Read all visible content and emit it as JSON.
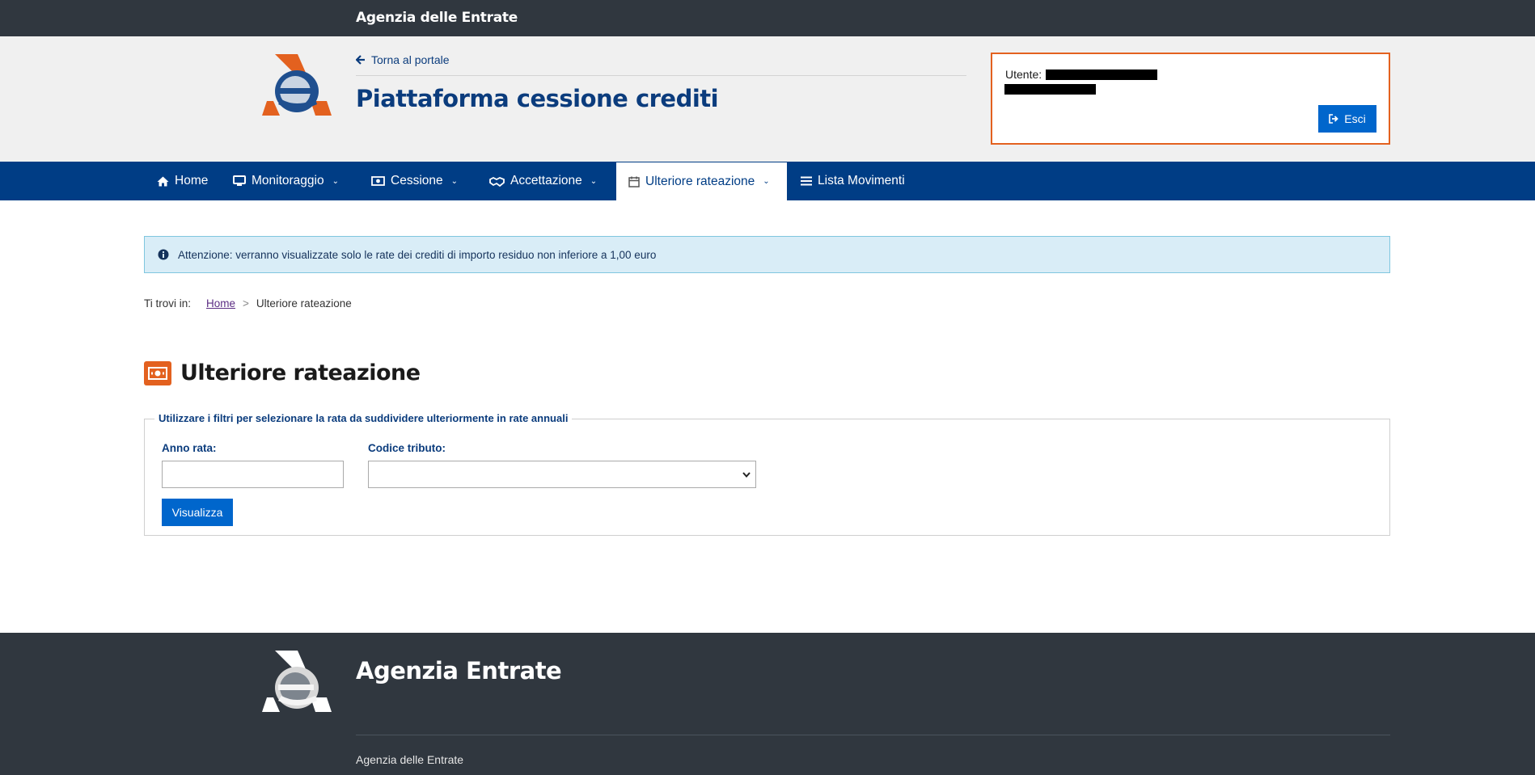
{
  "topbar": {
    "brand": "Agenzia delle Entrate"
  },
  "header": {
    "back_link": "Torna al portale",
    "title": "Piattaforma cessione crediti",
    "user_label": "Utente:",
    "logout_label": "Esci"
  },
  "nav": {
    "items": [
      {
        "label": "Home",
        "icon": "home-icon"
      },
      {
        "label": "Monitoraggio",
        "icon": "monitor-icon"
      },
      {
        "label": "Cessione",
        "icon": "money-icon"
      },
      {
        "label": "Accettazione",
        "icon": "handshake-icon"
      },
      {
        "label": "Ulteriore rateazione",
        "icon": "calendar-icon"
      },
      {
        "label": "Lista Movimenti",
        "icon": "list-icon"
      }
    ]
  },
  "alert": {
    "text": "Attenzione: verranno visualizzate solo le rate dei crediti di importo residuo non inferiore a 1,00 euro"
  },
  "breadcrumb": {
    "prefix": "Ti trovi in:",
    "home": "Home",
    "separator": ">",
    "current": "Ulteriore rateazione"
  },
  "page": {
    "title": "Ulteriore rateazione"
  },
  "filters": {
    "legend": "Utilizzare i filtri per selezionare la rata da suddividere ulteriormente in rate annuali",
    "anno_label": "Anno rata:",
    "anno_value": "",
    "codice_label": "Codice tributo:",
    "codice_value": "",
    "submit_label": "Visualizza"
  },
  "footer": {
    "title": "Agenzia Entrate",
    "subtitle": "Agenzia delle Entrate"
  },
  "colors": {
    "topbar": "#30373f",
    "nav": "#003d85",
    "accent_orange": "#e3611f",
    "button_blue": "#0066cc",
    "title_blue": "#0b3c7d",
    "alert_bg": "#d9edf7"
  }
}
